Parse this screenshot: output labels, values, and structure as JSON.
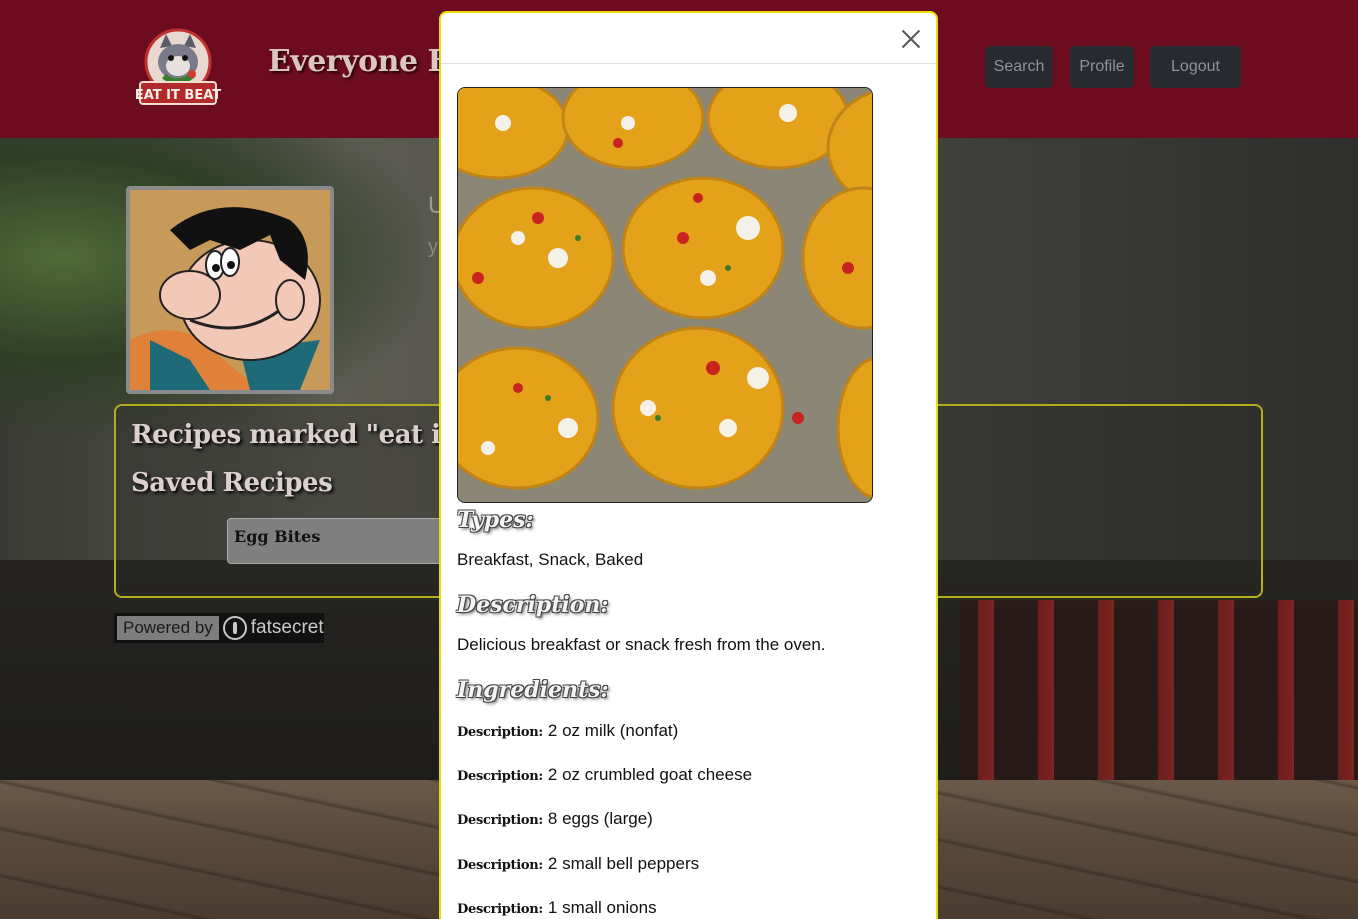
{
  "header": {
    "brand": "Everyone Eats",
    "logo_text": "EAT IT BEAT",
    "nav": {
      "search": "Search",
      "profile": "Profile",
      "logout": "Logout"
    }
  },
  "profile": {
    "partial_heading": "U",
    "partial_sub": "y"
  },
  "recipes_section": {
    "eat_it_heading": "Recipes marked \"eat it\"",
    "saved_heading": "Saved Recipes",
    "saved_items": [
      "Egg Bites"
    ]
  },
  "badge": {
    "powered_by": "Powered by",
    "brand": "fatsecret"
  },
  "modal": {
    "types_title": "Types:",
    "types_value": "Breakfast, Snack, Baked",
    "description_title": "Description:",
    "description_value": "Delicious breakfast or snack fresh from the oven.",
    "ingredients_title": "Ingredients:",
    "ingredient_label": "Description:",
    "ingredients": [
      "2 oz milk (nonfat)",
      "2 oz crumbled goat cheese",
      "8 eggs (large)",
      "2 small bell peppers",
      "1 small onions"
    ]
  },
  "colors": {
    "navbar": "#6d0c1e",
    "modal_border": "#e8e000",
    "box_border": "#b6ad1c",
    "nav_button": "#272b30"
  }
}
